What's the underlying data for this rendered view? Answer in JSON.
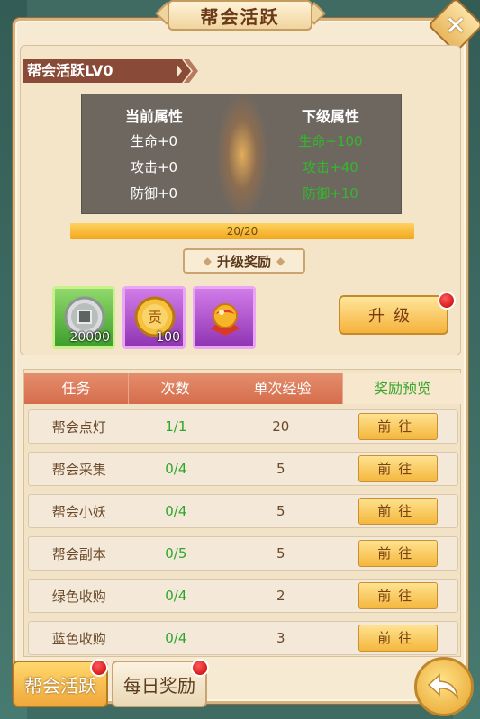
{
  "title": "帮会活跃",
  "close_label": "✕",
  "level_label": "帮会活跃LV0",
  "attributes": {
    "current_header": "当前属性",
    "next_header": "下级属性",
    "current": [
      "生命+0",
      "攻击+0",
      "防御+0"
    ],
    "next": [
      "生命+100",
      "攻击+40",
      "防御+10"
    ]
  },
  "progress": {
    "text": "20/20",
    "fraction": 1.0
  },
  "reward_label": "升级奖励",
  "rewards": [
    {
      "icon": "silver-coin-icon",
      "count": "20000",
      "rarity": "green"
    },
    {
      "icon": "contribution-coin-icon",
      "count": "100",
      "rarity": "purple"
    },
    {
      "icon": "gift-orb-icon",
      "count": "",
      "rarity": "purple"
    }
  ],
  "upgrade_button": "升级",
  "task_table": {
    "headers": [
      "任务",
      "次数",
      "单次经验",
      "奖励预览"
    ],
    "rows": [
      {
        "name": "帮会点灯",
        "count": "1/1",
        "exp": "20",
        "action": "前往"
      },
      {
        "name": "帮会采集",
        "count": "0/4",
        "exp": "5",
        "action": "前往"
      },
      {
        "name": "帮会小妖",
        "count": "0/4",
        "exp": "5",
        "action": "前往"
      },
      {
        "name": "帮会副本",
        "count": "0/5",
        "exp": "5",
        "action": "前往"
      },
      {
        "name": "绿色收购",
        "count": "0/4",
        "exp": "2",
        "action": "前往"
      },
      {
        "name": "蓝色收购",
        "count": "0/4",
        "exp": "3",
        "action": "前往"
      }
    ]
  },
  "tabs": {
    "active": "帮会活跃",
    "daily": "每日奖励"
  },
  "colors": {
    "accent": "#f5b23b",
    "green_text": "#2ea62a",
    "header_red": "#d56d4c",
    "panel_gray": "#6d6760"
  }
}
